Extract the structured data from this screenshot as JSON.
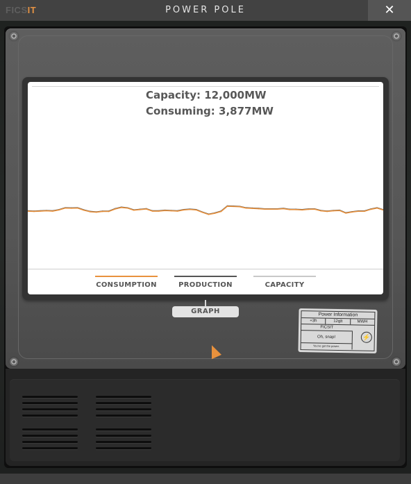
{
  "window": {
    "logo_text": "FICS",
    "logo_accent": "IT",
    "title": "POWER POLE",
    "close_icon": "close-icon"
  },
  "screen": {
    "capacity_text": "Capacity: 12,000MW",
    "consuming_text": "Consuming: 3,877MW",
    "legend": [
      {
        "label": "CONSUMPTION",
        "color": "#e8913d"
      },
      {
        "label": "PRODUCTION",
        "color": "#555555"
      },
      {
        "label": "CAPACITY",
        "color": "#c8c8c8"
      }
    ]
  },
  "graph_tab": {
    "label": "GRAPH"
  },
  "info_label": {
    "title": "Power Information",
    "row1": [
      "+3h",
      "12glt",
      "MWH"
    ],
    "brand": "FICSIT",
    "message": "Oh, snap!",
    "footer": "You've got the power.",
    "icon": "lightning-bolt-icon"
  },
  "chart_data": {
    "type": "line",
    "title": "",
    "xlabel": "",
    "ylabel": "",
    "ylim": [
      0,
      12000
    ],
    "grid": false,
    "legend_position": "bottom",
    "series": [
      {
        "name": "Consumption",
        "color": "#e8913d",
        "values": [
          3800,
          3780,
          3800,
          3820,
          3800,
          3880,
          4000,
          3990,
          4000,
          3860,
          3760,
          3730,
          3780,
          3780,
          3940,
          4040,
          4000,
          3860,
          3900,
          3940,
          3800,
          3800,
          3840,
          3820,
          3800,
          3880,
          3910,
          3880,
          3720,
          3580,
          3660,
          3780,
          4120,
          4110,
          4090,
          4000,
          3980,
          3960,
          3930,
          3930,
          3930,
          3960,
          3900,
          3900,
          3880,
          3920,
          3930,
          3820,
          3780,
          3820,
          3840,
          3670,
          3740,
          3790,
          3790,
          3920,
          4000,
          3877
        ]
      },
      {
        "name": "Production",
        "color": "#555555",
        "values": [
          3820,
          3800,
          3820,
          3840,
          3820,
          3900,
          4020,
          4010,
          4020,
          3880,
          3780,
          3750,
          3800,
          3800,
          3960,
          4060,
          4020,
          3880,
          3920,
          3960,
          3820,
          3820,
          3860,
          3840,
          3820,
          3900,
          3930,
          3900,
          3740,
          3600,
          3680,
          3800,
          4140,
          4130,
          4110,
          4020,
          4000,
          3980,
          3950,
          3950,
          3950,
          3980,
          3920,
          3920,
          3900,
          3940,
          3950,
          3840,
          3800,
          3840,
          3860,
          3690,
          3760,
          3810,
          3810,
          3940,
          4020,
          3897
        ]
      }
    ]
  }
}
